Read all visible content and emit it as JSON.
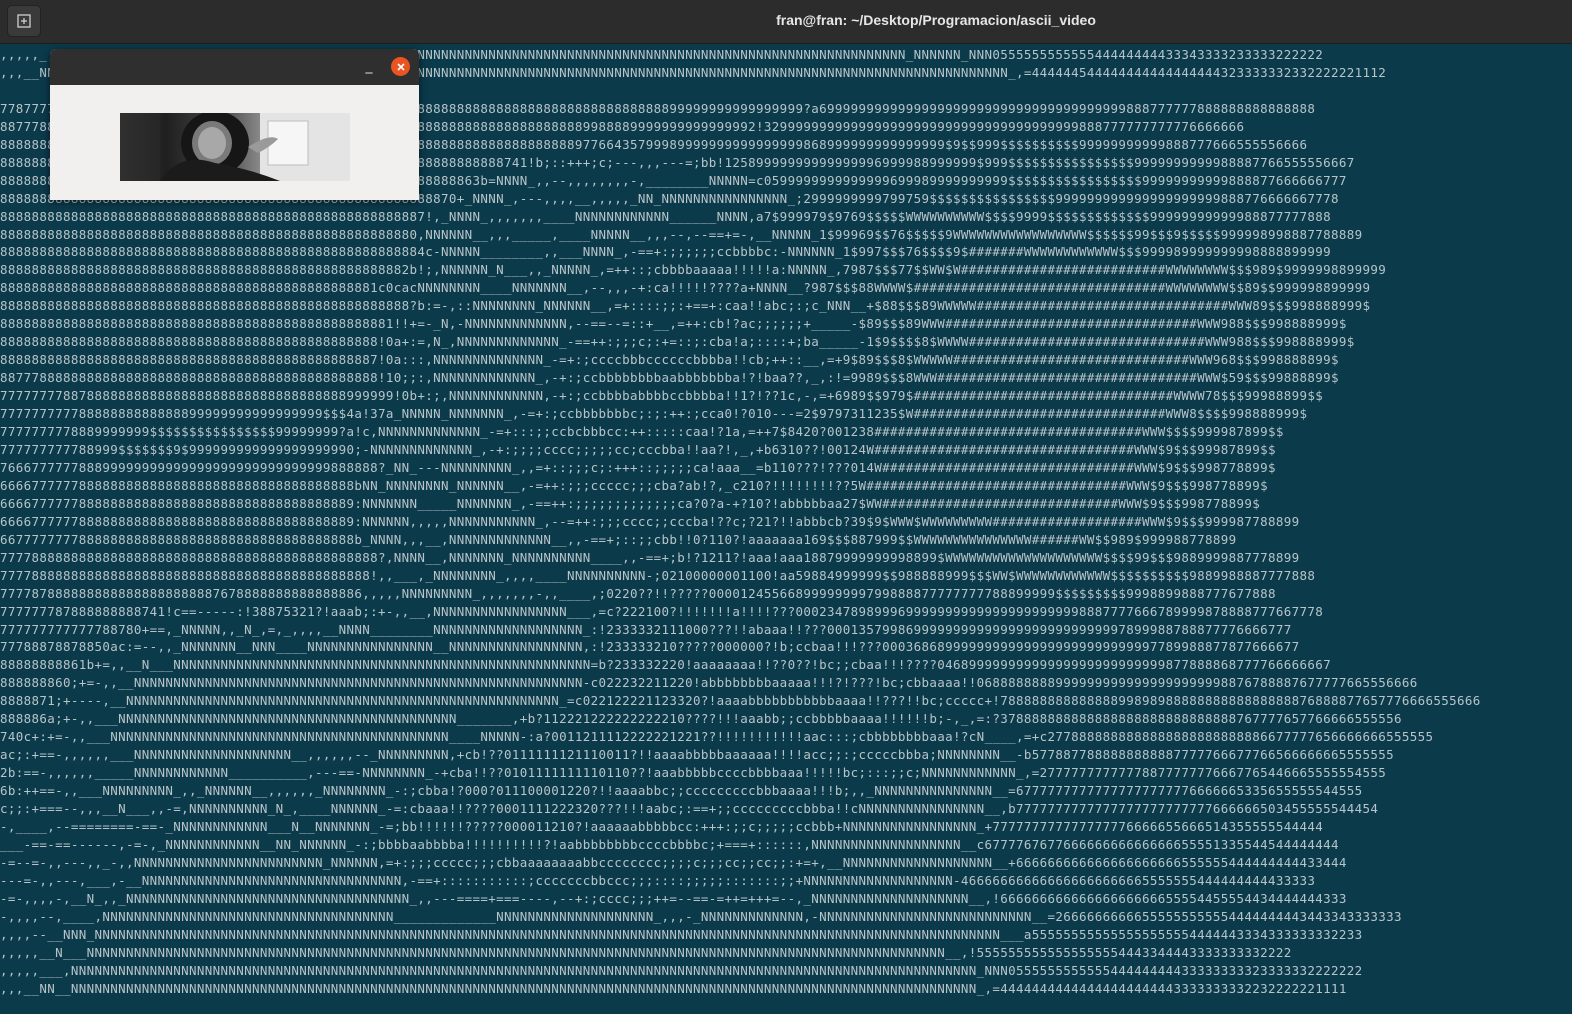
{
  "window": {
    "title": "fran@fran: ~/Desktop/Programacion/ascii_video",
    "new_tab_icon": "new-tab-icon"
  },
  "video_window": {
    "minimize_label": "_",
    "close_icon": "close-icon",
    "accent": "#e95420"
  },
  "colors": {
    "terminal_bg": "#0b3a4b",
    "terminal_fg": "#b7c4c8"
  },
  "terminal_lines": [
    ",,,,,_,,NNNNNNNNNNNNNNNNNNNNNNNNNNNNNNNNNNNNNNNNNNNNNNNNNNNNNNNNNNNNNNNNNNNNNNNNNNNNNNNNNNNNNNNNNNNNNNNNNNNNNNNNNNN_NNNNNN_NNN055555555555544444444433343333233333222222",
    ",,,__NNNNNNNNNNNNNNNNNNNNNNNNNNNNNNNNNNNNNNNNNNNNNNNNNNNNNNNNNNNNNNNNNNNNNNNNNNNNNNNNNNNNNNNNNNNNNNNNNNNNNNNNNNNNNNNNNNNNNNNNNNN_,=444444544444444444444444323333332332222221112",
    "",
    "778777788888888888888888888888888888888888888888888888888888888888888888888888888888899999999999999999?a699999999999999999999999999999999999999888777777888888888888888",
    "887778888888888888888888888888888888888888888888888888888888888888888888889988889999999999999992!3299999999999999999999999999999999999999888777777777776666666",
    "888888888888888888888888888888888888888888888888888888888888888888888888897766435799989999999999999999868999999999999999$9$$999$$$$$$$$$$99999999999888777666555556666",
    "8888888888888888888888888888888888888888888888888888888888888888741!b;::+++;c;---,,,---=;bb!12589999999999999996999988999999$999$$$$$$$$$$$$$$$$9999999999988887766555556667",
    "8888888888888888888888888888888888888888888888888888888888863b=NNNN_,,--,,,,,,,,-,________NNNNN=c0599999999999999699989999999999$$$$$$$$$$$$$$$$$99999999999888877666666777",
    "8888888888888888888888888888888888888888888888888888888870+_NNNN_,---,,,,__,,,,,_NN_NNNNNNNNNNNNNNNN_;2999999999799759$$$$$$$$$$$$$$$$999999999999999999999888776666667778",
    "888888888888888888888888888888888888888888888888888887!,_NNNN_,,,,,,,____NNNNNNNNNNNN______NNNN,a7$999979$9769$$$$$WWWWWWWWWW$$$$9999$$$$$$$$$$$$$99999999999988877777888",
    "88888888888888888888888888888888888888888888888888880,NNNNNN__,,,_____,____NNNNN__,,,--,--==+=-,__NNNNN_1$99969$$76$$$$$9WWWWWWWWWWWWWWWWW$$$$$$99$$$9$$$$$999998998887788889",
    "888888888888888888888888888888888888888888888888888884c-NNNNN________,,___NNNN_,-==+:;;;;;;ccbbbbc:-NNNNNN_1$997$$$76$$$$9$#######WWWWWWWWWWWW$$$999989999999998888899999",
    "8888888888888888888888888888888888888888888888888882b!;,NNNNNN_N___,,_NNNNN_,=++::;cbbbbaaaaa!!!!!a:NNNNN_,7987$$$77$$WW$W##########################WWWWWWWW$$$989$9999998899999",
    "888888888888888888888888888888888888888888888881c0cacNNNNNNNN____NNNNNNN__,--,,,-+:ca!!!!!????a+NNNN__?987$$$88WWWW$################################WWWWWWWW$$89$$999998899999",
    "8888888888888888888888888888888888888888888888888888?b:=-,::NNNNNNNN_NNNNNN__,=+::::;;:+==+:caa!!abc;:;c_NNN__+$88$$$89WWWWW################################WWW89$$$998888999$",
    "88888888888888888888888888888888888888888888888881!!+=-_N,-NNNNNNNNNNNNN,--==--=::+__,=++:cb!?ac;;;;;;+_____-$89$$$89WWW################################WWW988$$$998888999$",
    "888888888888888888888888888888888888888888888888!0a+:=,N_,NNNNNNNNNNNNN_-==++:;;;c;:+=::;:cba!a;::::+;ba_____-1$9$$$$8$WWWW##############################WWW988$$$998888999$",
    "888888888888888888888888888888888888888888888887!0a:::,NNNNNNNNNNNNNN_-=+:;ccccbbbccccccbbbba!!cb;++::__,=+9$89$$$8$WWWWW##############################WWW968$$$998888899$",
    "887778888888888888888888888888888888888888888888!10;;:,NNNNNNNNNNNNN_,-+:;ccbbbbbbbbaabbbbbbba!?!baa??,_,:!=9989$$$8WWW#################################WWW$59$$$99888899$",
    "77777777887888888888888888888888888888888888999999!0b+:;,NNNNNNNNNNNN,-+:;ccbbbbabbbbccbbbba!!1?!??1c,-,=+6989$$979$#################################WWWW78$$$99988899$$",
    "77777777778888888888888899999999999999999$$$4a!37a_NNNNN_NNNNNNN_,-=+:;ccbbbbbbbc;:;:++:;cca0!?010---=2$9797311235$W################################WWW8$$$$998888999$",
    "7777777778889999999$$$$$$$$$$$$$$$$99999999?a!c,NNNNNNNNNNNNN_-=+:::;;ccbcbbbcc:++:::::caa!?1a,=++7$8420?001238##################################WWW$$$$999987899$$",
    "777777777788999$$$$$$$9$999999999999999999990;-NNNNNNNNNNNNN_,-+:;;;;cccc;;;;;cc;cccbba!!aa?!,_,+b6310??!00124W#################################WWW$9$$$99987899$$",
    "766677777788899999999999999999999999999999888888?_NN_---NNNNNNNNN_,,=+::;;;c;:+++::;;;;;ca!aaa__=b110???!???014W################################WWW$9$$$998778899$",
    "666677777788888888888888888888888888888888888bNN_NNNNNNNN_NNNNNN__,-=++:;;;ccccc;;;cba?ab!?,_c210?!!!!!!!!??5W#################################WWW$9$$$998778899$",
    "666677777788888888888888888888888888888888889:NNNNNNN_____NNNNNNN_,-==++:;;;;;;;;;;;;;ca?0?a-+?10?!abbbbbaa27$WW##############################WWW$9$$$998778899$",
    "666677777788888888888888888888888888888888889:NNNNNN,,,,,NNNNNNNNNNN_,--=++:;;;cccc;;cccba!??c;?21?!!abbbcb?39$9$WWW$WWWWWWWWW###################WWW$9$$$999987788899",
    "667777777788888888888888888888888888888888888b_NNNN,,,__,NNNNNNNNNNNNN__,,-==+;::;;cbb!!0?110?!aaaaaaa169$$$887999$$WWWWWWWWWWWWWWW######WW$$989$999988778899",
    "777788888888888888888888888888888888888888888888?,NNNN__,NNNNNNN_NNNNNNNNNN____,,-==+;b!?1211?!aaa!aaa18879999999998899$WWWWWWWWWWWWWWWWWWWW$$$$99$$$9889999887778899",
    "77778888888888888888888888888888888888888888888!,,___,_NNNNNNNN_,,,,____NNNNNNNNNN-;02100000001100!aa59884999999$$988888999$$$WW$WWWWWWWWWWWW$$$$$$$$$$9889988887777888",
    "7777878888888888888888888887678888888888888886,,,,,NNNNNNNNN_,,,,,,,-,,____,;0220??!!?????00001245566899999999799888877777777788899999$$$$$$$$$9998899888777677888",
    "777777787888888888741!c==-----:!38875321?!aaab;:+-,,__,NNNNNNNNNNNNNNNNN___,=c?222100?!!!!!!!a!!!!???0002347898999699999999999999999999998887777666789999878888777667778",
    "777777777777788780+==,_NNNNN,,_N_,=,_,,,,__NNNN________NNNNNNNNNNNNNNNNNNN_:!2333332111000???!!abaaa!!???00013579986999999999999999999999999997899988788877776666777",
    "77788878878850ac:=--,,_NNNNNNN__NNN____NNNNNNNNNNNNNNNN__NNNNNNNNNNNNNNNNN,:!233333210?????000000?!b;ccbaa!!!???00036868999999999999999999999999997789988877877666677",
    "88888888861b+=,,__N___NNNNNNNNNNNNNNNNNNNNNNNNNNNNNNNNNNNNNNNNNNNNNNNNNNNNN=b?233332220!aaaaaaaa!!??0??!bc;;cbaa!!!????04689999999999999999999999999877888868777766666667",
    "888888860;+=-,,__NNNNNNNNNNNNNNNNNNNNNNNNNNNNNNNNNNNNNNNNNNNNNNNNNNNNNNNNN-c022232211220!abbbbbbbbaaaaa!!!?!???!bc;cbbaaaa!!06888888889999999999999999999998876788887677777665556666",
    "8888871;+----,__NNNNNNNNNNNNNNNNNNNNNNNNNNNNNNNNNNNNNNNNNNNNNNNNNNNNNNN_=c022122221123320?!aaaabbbbbbbbbbbaaaa!!???!!bc;ccccc+!7888888888888889989898888888888888888876888877657776666555666",
    "888886a;+-,,___NNNNNNNNNNNNNNNNNNNNNNNNNNNNNNNNNNNNNNNNNNN_______,+b?112221222222222210????!!!aaabb;;ccbbbbbaaaa!!!!!!b;-,_,=:?378888888888888888888888888888767777657766666555556",
    "740c+:+=-,,___NNNNNNNNNNNNNNNNNNNNNNNNNNNNNNNNNNNNNNNNNNN____NNNNN-:a?0011211112222221221??!!!!!!!!!!!aac:::;cbbbbbbbbaaa!?cN____,=+c2778888888888888888888888886677777656666666555555",
    "ac;:+==-,,,,,,___NNNNNNNNNNNNNNNNNNNN__,,,,,,--_NNNNNNNNN,+cb!??0111111121110011?!!aaaabbbbbaaaaaa!!!!acc;;:;cccccbbba;NNNNNNNN__-b5778877888888888887777766677766566666665555555",
    "2b:==-,,,,,,_____NNNNNNNNNNNN__________,---==-NNNNNNNN_-+cba!!??0101111111110110??!aaabbbbbccccbbbbaaa!!!!!bc;:::;;c;NNNNNNNNNNNN_,=27777777777778877777776667765446665555554555",
    "6b:++==-,,___NNNNNNNNN_,,_NNNNNN__,,,,,,_NNNNNNNN_-:;cbba!?000?011100001220?!!aaaabbc;;cccccccccbbbaaaa!!!b;,,_NNNNNNNNNNNNNNN__=67777777777777777777776666665335655555544555",
    "c;;:+===--,,,__N___,,-=,NNNNNNNNNN_N_,____NNNNNN_-=:cbaaa!!????0001111222320???!!!aabc;:==+;;cccccccccbbba!!cNNNNNNNNNNNNNNNN__,b7777777777777777777777777666666503455555544454",
    "-,____,--========-==-_NNNNNNNNNNNN___N__NNNNNNN_-=;bb!!!!!!?????000011210?!aaaaaabbbbbcc:+++:;;c;;;;;ccbbb+NNNNNNNNNNNNNNNNN_+777777777777777776666655666514355555544444",
    "___-==-==------,-=-,_NNNNNNNNNNNN__NN_NNNNNN_-:;bbbbaabbbba!!!!!!!!!!?!aabbbbbbbbccccbbbbc;+===+::::::,NNNNNNNNNNNNNNNNNNN__c677776767766666666666666655551335544544444444",
    "-=--=-,,---,,_-,,NNNNNNNNNNNNNNNNNNNNNNNN_NNNNNN,=+:;;;ccccc;;;cbbaaaaaaaabbcccccccc;;;;c;;;cc;;cc;;:+=+,__NNNNNNNNNNNNNNNNNNN__+666666666666666666666555555444444444433444",
    "---=-,,---,___,-__NNNNNNNNNNNNNNNNNNNNNNNNNNNNNNNNN,-==+:::::::::::;cccccccbbccc;;;::::;;;;;:::::::;;+NNNNNNNNNNNNNNNNNNN-466666666666666666666665555555444444444433333",
    "-=-,,,,-,__N_,,_NNNNNNNNNNNNNNNNNNNNNNNNNNNNNNNNNNNN_,,---====+===----,--+:;cccc;;;++=--==-=++=+++=--,_NNNNNNNNNNNNNNNNNNNN__,!66666666666666666666655554455554434444444333",
    "-,,,,--,____,NNNNNNNNNNNNNNNNNNNNNNNNNNNNNNNNNNNNN_____________NNNNNNNNNNNNNNNNNNNN_,,,-_NNNNNNNNNNNNN,-NNNNNNNNNNNNNNNNNNNNNNNNNNN__=26666666666555555555554444444443443343333333",
    ",,,,--__NNN_NNNNNNNNNNNNNNNNNNNNNNNNNNNNNNNNNNNNNNNNNNNNNNNNNNNNNNNNNNNNNNNNNNNNNNNNNNNNNNNNNNNNNNNNNNNNNNNNNNNNNNNNNNNNNNNNNNN___a555555555555555555554444443334333333332233",
    ",,,,,__N___NNNNNNNNNNNNNNNNNNNNNNNNNNNNNNNNNNNNNNNNNNNNNNNNNNNNNNNNNNNNNNNNNNNNNNNNNNNNNNNNNNNNNNNNNNNNNNNNNNNNNNNNNNNNN__,!5555555555555555554443344443333333332222",
    ",,,,,___,NNNNNNNNNNNNNNNNNNNNNNNNNNNNNNNNNNNNNNNNNNNNNNNNNNNNNNNNNNNNNNNNNNNNNNNNNNNNNNNNNNNNNNNNNNNNNNNNNNNNNNNNNNNNNNNNNNN_NNN055555555555544444444433333333323333332222222",
    ",,,__NN__NNNNNNNNNNNNNNNNNNNNNNNNNNNNNNNNNNNNNNNNNNNNNNNNNNNNNNNNNNNNNNNNNNNNNNNNNNNNNNNNNNNNNNNNNNNNNNNNNNNNNNNNNNNNNNNNNNN_,=44444444444444444444443333333332232222221111"
  ]
}
